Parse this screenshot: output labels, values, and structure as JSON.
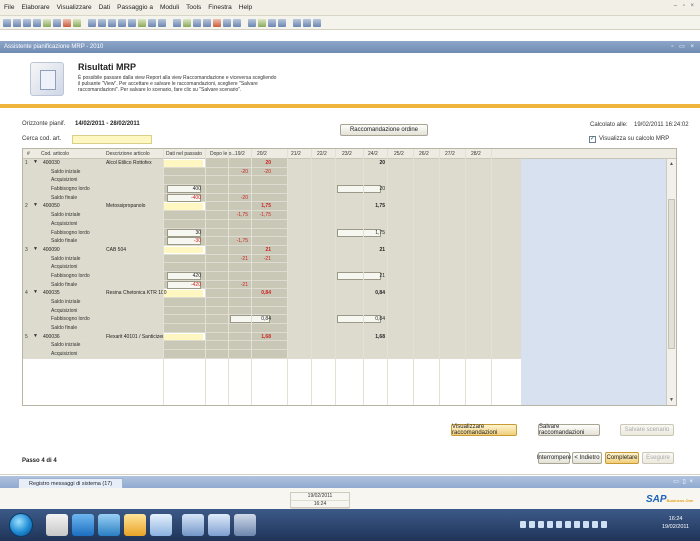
{
  "menu": [
    "File",
    "Elaborare",
    "Visualizzare",
    "Dati",
    "Passaggio a",
    "Moduli",
    "Tools",
    "Finestra",
    "Help"
  ],
  "window": {
    "title": "Assistente pianificazione MRP - 2010"
  },
  "header": {
    "title": "Risultati MRP",
    "description": "È possibile passare dalla view Report alla view Raccomandazione e viceversa scegliendo il pulsante \"View\". Per accettare e salvare le raccomandazioni, scegliere \"Salvare raccomandazioni\". Per salvare lo scenario, fare clic su \"Salvare scenario\"."
  },
  "form": {
    "horizon_label": "Orizzonte pianif.",
    "horizon_value": "14/02/2011  -  28/02/2011",
    "search_label": "Cerca cod. art.",
    "search_value": "",
    "order_button": "Raccomandazione ordine",
    "calc_label": "Calcolato alle:",
    "calc_value": "19/02/2011  16:24:02",
    "show_calc_label": "Visualizza su calcolo MRP",
    "show_calc_checked": true
  },
  "grid": {
    "headers": {
      "num": "#",
      "code": "Cod. articolo",
      "desc": "Descrizione articolo",
      "past": "Dati nel passato",
      "after": "Dopo le o...",
      "days": [
        "19/2",
        "20/2",
        "21/2",
        "22/2",
        "23/2",
        "24/2",
        "25/2",
        "26/2",
        "27/2",
        "28/2"
      ]
    },
    "items": [
      {
        "num": "1",
        "code": "400030",
        "desc": "Alcol Etilico Rottofex",
        "d19": "",
        "d20": "20",
        "d23": "",
        "d24": "20",
        "subs": [
          {
            "label": "Saldo iniziale",
            "d19": "-20",
            "d20": "-20",
            "d23": ""
          },
          {
            "label": "Acquisizioni",
            "d23": ""
          },
          {
            "label": "Fabbisogno lordo",
            "past": "400",
            "d23": "20"
          },
          {
            "label": "Saldo finale",
            "past": "-400",
            "d19": "-20",
            "d23": ""
          }
        ]
      },
      {
        "num": "2",
        "code": "400050",
        "desc": "Metossipropanolo",
        "d19": "",
        "d20": "1,75",
        "d23": "",
        "d24": "1,75",
        "subs": [
          {
            "label": "Saldo iniziale",
            "d19": "-1,75",
            "d20": "-1,75",
            "d23": ""
          },
          {
            "label": "Acquisizioni",
            "d23": ""
          },
          {
            "label": "Fabbisogno lordo",
            "past": "30",
            "d23": "1,75"
          },
          {
            "label": "Saldo finale",
            "past": "-30",
            "d19": "-1,75",
            "d23": ""
          }
        ]
      },
      {
        "num": "3",
        "code": "400090",
        "desc": "CAB 504",
        "d19": "",
        "d20": "21",
        "d23": "",
        "d24": "21",
        "subs": [
          {
            "label": "Saldo iniziale",
            "d19": "-21",
            "d20": "-21",
            "d23": ""
          },
          {
            "label": "Acquisizioni",
            "d23": ""
          },
          {
            "label": "Fabbisogno lordo",
            "past": "420",
            "d23": "21"
          },
          {
            "label": "Saldo finale",
            "past": "-420",
            "d19": "-21",
            "d23": ""
          }
        ]
      },
      {
        "num": "4",
        "code": "400035",
        "desc": "Resina Chetonica KTR 100",
        "d19": "",
        "d20": "0,84",
        "d23": "",
        "d24": "0,84",
        "subs": [
          {
            "label": "Saldo iniziale",
            "d23": ""
          },
          {
            "label": "Acquisizioni",
            "d23": ""
          },
          {
            "label": "Fabbisogno lordo",
            "after": "0,84",
            "d23": "0,84"
          },
          {
            "label": "Saldo finale",
            "d23": ""
          }
        ]
      },
      {
        "num": "5",
        "code": "400036",
        "desc": "Flexarit 40101 / Santicizer",
        "d19": "",
        "d20": "1,68",
        "d23": "",
        "d24": "1,68",
        "subs": [
          {
            "label": "Saldo iniziale",
            "d23": ""
          },
          {
            "label": "Acquisizioni",
            "d23": ""
          }
        ]
      }
    ]
  },
  "actions": {
    "view_recommendations": "Visualizzare raccomandazioni",
    "save_recommendations": "Salvare raccomandazioni",
    "save_scenario": "Salvare scenario"
  },
  "wizard": {
    "step": "Passo 4 di 4",
    "interrupt": "Interrompere",
    "back": "< Indietro",
    "finish": "Completare",
    "next": "Eseguire"
  },
  "messages": {
    "tab": "Registro messaggi di sistema (17)"
  },
  "status": {
    "date": "19/02/2011",
    "time": "16:24"
  },
  "brand": {
    "name": "SAP",
    "sub": "Business One"
  },
  "taskbar": {
    "time": "16:24",
    "date": "19/02/2011"
  },
  "colors": {
    "accent": "#f0b43c",
    "title_bar": "#7b95bd",
    "input": "#fff7c2",
    "negative": "#cc2222"
  }
}
